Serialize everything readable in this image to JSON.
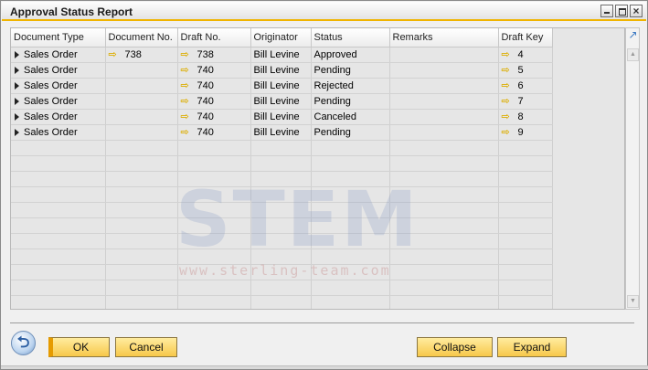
{
  "window": {
    "title": "Approval Status Report"
  },
  "grid": {
    "columns": [
      "Document Type",
      "Document No.",
      "Draft No.",
      "Originator",
      "Status",
      "Remarks",
      "Draft Key"
    ],
    "rows": [
      {
        "document_type": "Sales Order",
        "document_no": "738",
        "draft_no": "738",
        "originator": "Bill Levine",
        "status": "Approved",
        "remarks": "",
        "draft_key": "4"
      },
      {
        "document_type": "Sales Order",
        "document_no": "",
        "draft_no": "740",
        "originator": "Bill Levine",
        "status": "Pending",
        "remarks": "",
        "draft_key": "5"
      },
      {
        "document_type": "Sales Order",
        "document_no": "",
        "draft_no": "740",
        "originator": "Bill Levine",
        "status": "Rejected",
        "remarks": "",
        "draft_key": "6"
      },
      {
        "document_type": "Sales Order",
        "document_no": "",
        "draft_no": "740",
        "originator": "Bill Levine",
        "status": "Pending",
        "remarks": "",
        "draft_key": "7"
      },
      {
        "document_type": "Sales Order",
        "document_no": "",
        "draft_no": "740",
        "originator": "Bill Levine",
        "status": "Canceled",
        "remarks": "",
        "draft_key": "8"
      },
      {
        "document_type": "Sales Order",
        "document_no": "",
        "draft_no": "740",
        "originator": "Bill Levine",
        "status": "Pending",
        "remarks": "",
        "draft_key": "9"
      }
    ],
    "empty_row_count": 11
  },
  "watermark": {
    "text": "STEM",
    "url": "www.sterling-team.com"
  },
  "buttons": {
    "ok": "OK",
    "cancel": "Cancel",
    "collapse": "Collapse",
    "expand": "Expand"
  },
  "colors": {
    "title_accent": "#f0b400",
    "button_fill": "#f7c84a",
    "link_arrow": "#e6b800"
  },
  "icons": {
    "back": "back-arrow-icon",
    "link": "link-arrow-icon",
    "expand_row": "expand-triangle-icon"
  }
}
